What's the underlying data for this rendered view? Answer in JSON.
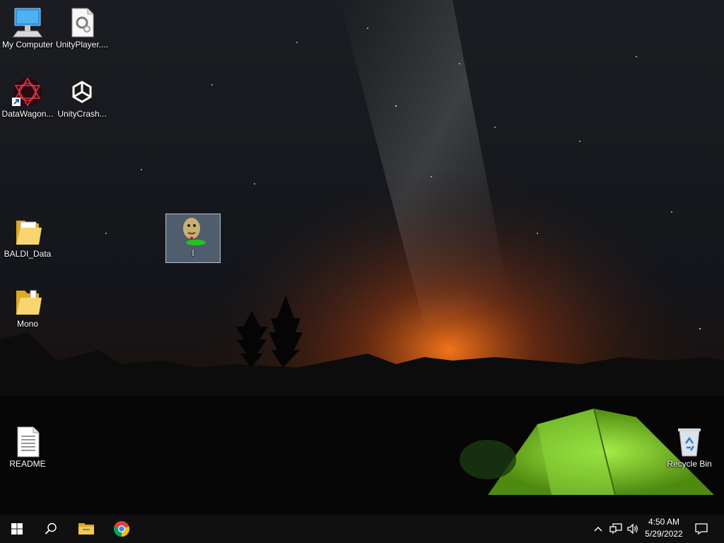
{
  "desktop": {
    "icons": [
      {
        "label": "My Computer",
        "icon": "computer-icon"
      },
      {
        "label": "UnityPlayer....",
        "icon": "dll-settings-icon"
      },
      {
        "label": "DataWagon...",
        "icon": "datawagon-shortcut-icon"
      },
      {
        "label": "UnityCrash...",
        "icon": "unity-icon"
      },
      {
        "label": "I",
        "icon": "baldi-app-icon",
        "selected": true
      },
      {
        "label": "BALDI_Data",
        "icon": "folder-icon"
      },
      {
        "label": "Mono",
        "icon": "folder-icon"
      },
      {
        "label": "README",
        "icon": "text-document-icon"
      },
      {
        "label": "Recycle Bin",
        "icon": "recycle-bin-icon"
      }
    ]
  },
  "taskbar": {
    "pinned": [
      {
        "name": "start",
        "icon": "windows-logo-icon"
      },
      {
        "name": "search",
        "icon": "search-icon"
      },
      {
        "name": "file-explorer",
        "icon": "folder-icon"
      },
      {
        "name": "chrome",
        "icon": "chrome-icon"
      }
    ],
    "tray": {
      "icons": [
        "chevron-up-icon",
        "network-icon",
        "volume-icon"
      ],
      "time": "4:50 AM",
      "date": "5/29/2022",
      "notification_icon": "notification-icon"
    }
  },
  "colors": {
    "taskbar": "#101010",
    "selection": "#99b4d1",
    "folder": "#f2c94c",
    "tent": "#7ed321",
    "horizon_glow": "#ff7a1a"
  }
}
